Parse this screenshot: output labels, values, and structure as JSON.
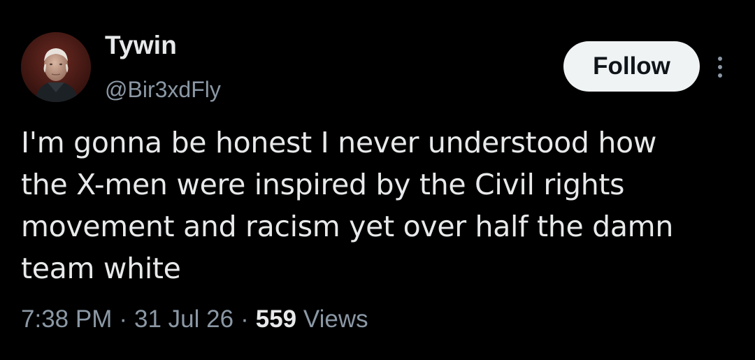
{
  "tweet": {
    "author": {
      "display_name": "Tywin",
      "handle": "@Bir3xdFly",
      "avatar_icon": "profile-photo"
    },
    "follow_label": "Follow",
    "more_icon": "more-options-icon",
    "text": "I'm gonna be honest I never understood how\nthe X-men were inspired by the Civil rights\nmovement and racism yet over half the damn\nteam white",
    "time": "7:38 PM",
    "separator": "·",
    "date": "31 Jul 26",
    "views_count": "559",
    "views_label": "Views"
  },
  "colors": {
    "background": "#000000",
    "primary_text": "#e7e9ea",
    "secondary_text": "#8b98a5",
    "button_bg": "#eff3f4",
    "button_text": "#0f1419"
  }
}
